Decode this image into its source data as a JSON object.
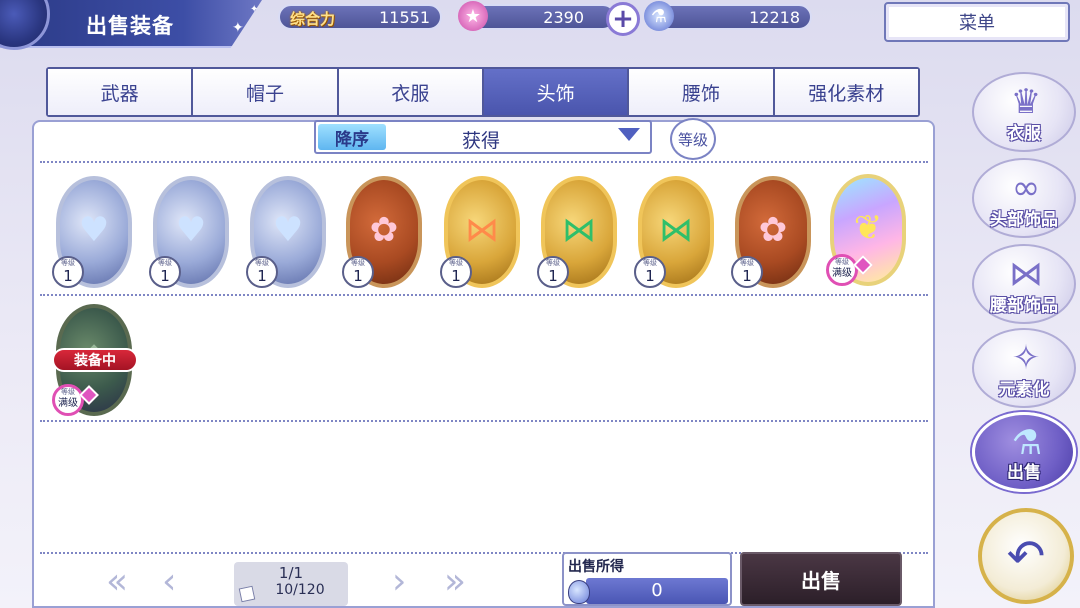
{
  "header": {
    "title": "出售装备",
    "power": {
      "label": "综合力",
      "value": "11551"
    },
    "stars": {
      "value": "2390"
    },
    "potions": {
      "value": "12218"
    },
    "menu_label": "菜单"
  },
  "tabs": [
    {
      "label": "武器",
      "active": false
    },
    {
      "label": "帽子",
      "active": false
    },
    {
      "label": "衣服",
      "active": false
    },
    {
      "label": "头饰",
      "active": true
    },
    {
      "label": "腰饰",
      "active": false
    },
    {
      "label": "强化素材",
      "active": false
    }
  ],
  "sort": {
    "order_label": "降序",
    "criteria": "获得",
    "level_button": "等级"
  },
  "items": [
    {
      "frame": "silver",
      "decoration": "heart-necklace",
      "level_caption": "等级",
      "level": "1"
    },
    {
      "frame": "silver",
      "decoration": "heart-necklace",
      "level_caption": "等级",
      "level": "1"
    },
    {
      "frame": "silver",
      "decoration": "heart-necklace",
      "level_caption": "等级",
      "level": "1"
    },
    {
      "frame": "copper",
      "decoration": "flower-hairpin",
      "level_caption": "等级",
      "level": "1"
    },
    {
      "frame": "gold",
      "decoration": "orange-ribbon-earrings",
      "level_caption": "等级",
      "level": "1"
    },
    {
      "frame": "gold",
      "decoration": "green-ribbon-earrings",
      "level_caption": "等级",
      "level": "1"
    },
    {
      "frame": "gold",
      "decoration": "green-ribbon-earrings",
      "level_caption": "等级",
      "level": "1"
    },
    {
      "frame": "copper",
      "decoration": "flower-hairpin",
      "level_caption": "等级",
      "level": "1"
    },
    {
      "frame": "rainbow",
      "decoration": "butterfly-wings",
      "level_caption": "等级",
      "level": "满级",
      "max": true
    }
  ],
  "equipped_item": {
    "frame": "dark",
    "decoration": "dark-ornament",
    "tag": "装备中",
    "level_caption": "等级",
    "level": "满级",
    "max": true
  },
  "pagination": {
    "page": "1/1",
    "capacity": "10/120"
  },
  "proceeds": {
    "label": "出售所得",
    "value": "0"
  },
  "sell_label": "出售",
  "side_nav": [
    {
      "label": "衣服",
      "icon": "dress-icon",
      "active": false
    },
    {
      "label": "头部饰品",
      "icon": "glasses-icon",
      "active": false
    },
    {
      "label": "腰部饰品",
      "icon": "bow-icon",
      "active": false
    },
    {
      "label": "元素化",
      "icon": "crystal-icon",
      "active": false
    },
    {
      "label": "出售",
      "icon": "potion-bottles-icon",
      "active": true
    }
  ],
  "colors": {
    "accent": "#4a55ad",
    "equipped_tag": "#c41e30",
    "max_level": "#e04fb4"
  }
}
